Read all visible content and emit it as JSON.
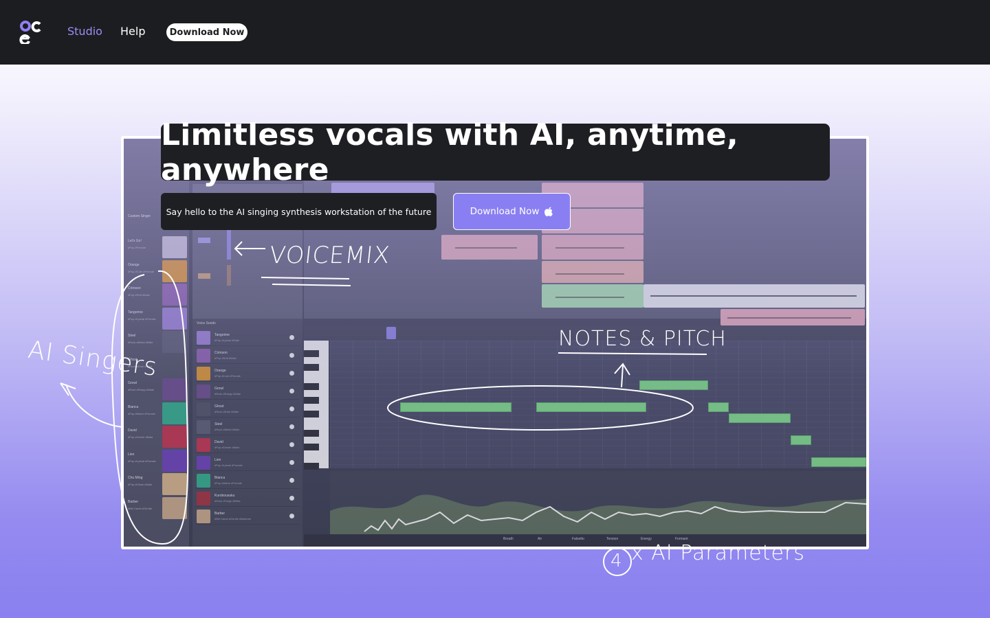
{
  "nav": {
    "logo_icon": "ace-logo-icon",
    "studio": "Studio",
    "help": "Help",
    "download": "Download Now"
  },
  "hero": {
    "title": "Limitless vocals with AI, anytime, anywhere",
    "subtitle": "Say hello to the AI singing synthesis workstation of the future",
    "download": "Download Now",
    "download_icon": "apple-icon"
  },
  "annotations": {
    "voicemix": "VOICEMIX",
    "notes_pitch": "NOTES & PITCH",
    "ai_singers": "AI Singers",
    "params_num": "4",
    "params_text": "x AI Parameters"
  },
  "app": {
    "sidebar_header": "Custom Singer",
    "singers": [
      {
        "name": "Let's Go!",
        "tags": "#Pop #Female",
        "color": "#c9c3d6"
      },
      {
        "name": "Orange",
        "tags": "#Pop #Cute #Female",
        "color": "#e0962e"
      },
      {
        "name": "Crimson",
        "tags": "#Pop #Soft #Male",
        "color": "#8e5fb0"
      },
      {
        "name": "Tangerine",
        "tags": "#Pop #Lyrical #Female",
        "color": "#9a7fd6"
      },
      {
        "name": "Steel",
        "tags": "#Rock #Metal #Male",
        "color": "#5a5c72"
      },
      {
        "name": "Ghost",
        "tags": "#Rock #Dark #Male",
        "color": "#4e5064"
      },
      {
        "name": "Growl",
        "tags": "#Rock #Raspy #Male",
        "color": "#6a4a8c"
      },
      {
        "name": "Bianca",
        "tags": "#Pop #Warm #Female",
        "color": "#2fae8a"
      },
      {
        "name": "David",
        "tags": "#Pop #Gentle #Male",
        "color": "#c2304a"
      },
      {
        "name": "Lien",
        "tags": "#Pop #Lyrical #Female",
        "color": "#6b3fb8"
      },
      {
        "name": "Chu Ming",
        "tags": "#Pop #Clean #Male",
        "color": "#d8b48a"
      },
      {
        "name": "Barber",
        "tags": "#Bel Canto #Gentle",
        "color": "#c9a88a"
      }
    ],
    "seeds_header": "Voice Seeds",
    "seeds": [
      {
        "name": "Tangerine",
        "tags": "#Pop #Lyrical #Male",
        "color": "#9a7fd6"
      },
      {
        "name": "Crimson",
        "tags": "#Pop #Soft #Male",
        "color": "#8e5fb0"
      },
      {
        "name": "Orange",
        "tags": "#Pop #Cute #Female",
        "color": "#e0962e"
      },
      {
        "name": "Growl",
        "tags": "#Rock #Raspy #Male",
        "color": "#6a4a8c"
      },
      {
        "name": "Ghost",
        "tags": "#Rock #Dark #Male",
        "color": "#4e5064"
      },
      {
        "name": "Steel",
        "tags": "#Rock #Metal #Male",
        "color": "#5a5c72"
      },
      {
        "name": "David",
        "tags": "#Pop #Gentle #Male",
        "color": "#c2304a"
      },
      {
        "name": "Lien",
        "tags": "#Pop #Lyrical #Female",
        "color": "#6b3fb8"
      },
      {
        "name": "Bianca",
        "tags": "#Pop #Warm #Female",
        "color": "#2fae8a"
      },
      {
        "name": "Kurobousuku",
        "tags": "#Rock #Tough #Male",
        "color": "#a3303e"
      },
      {
        "name": "Barber",
        "tags": "#Bel Canto #Gentle #Baritone",
        "color": "#c9a88a"
      }
    ],
    "param_tabs": [
      "Breath",
      "Air",
      "Falsetto",
      "Tension",
      "Energy",
      "Formant"
    ]
  }
}
